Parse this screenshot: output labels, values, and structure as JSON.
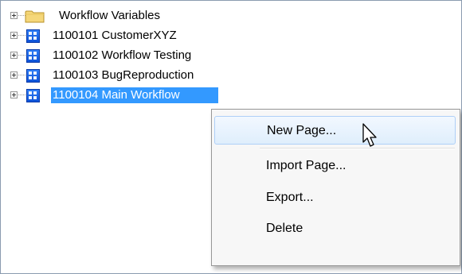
{
  "tree": {
    "items": [
      {
        "label": "Workflow Variables",
        "icon": "folder-icon"
      },
      {
        "label": "1100101 CustomerXYZ",
        "icon": "workflow-icon"
      },
      {
        "label": "1100102 Workflow Testing",
        "icon": "workflow-icon"
      },
      {
        "label": "1100103 BugReproduction",
        "icon": "workflow-icon"
      },
      {
        "label": "1100104 Main Workflow",
        "icon": "workflow-icon",
        "selected": true
      }
    ]
  },
  "context_menu": {
    "items": [
      {
        "label": "New Page...",
        "hovered": true
      },
      {
        "label": "Import Page..."
      },
      {
        "label": "Export..."
      },
      {
        "label": "Delete"
      }
    ]
  },
  "colors": {
    "selection": "#3399ff",
    "workflow_icon": "#1a5fe6",
    "folder": "#f5d77a",
    "menu_hover": "#dfeefc"
  }
}
